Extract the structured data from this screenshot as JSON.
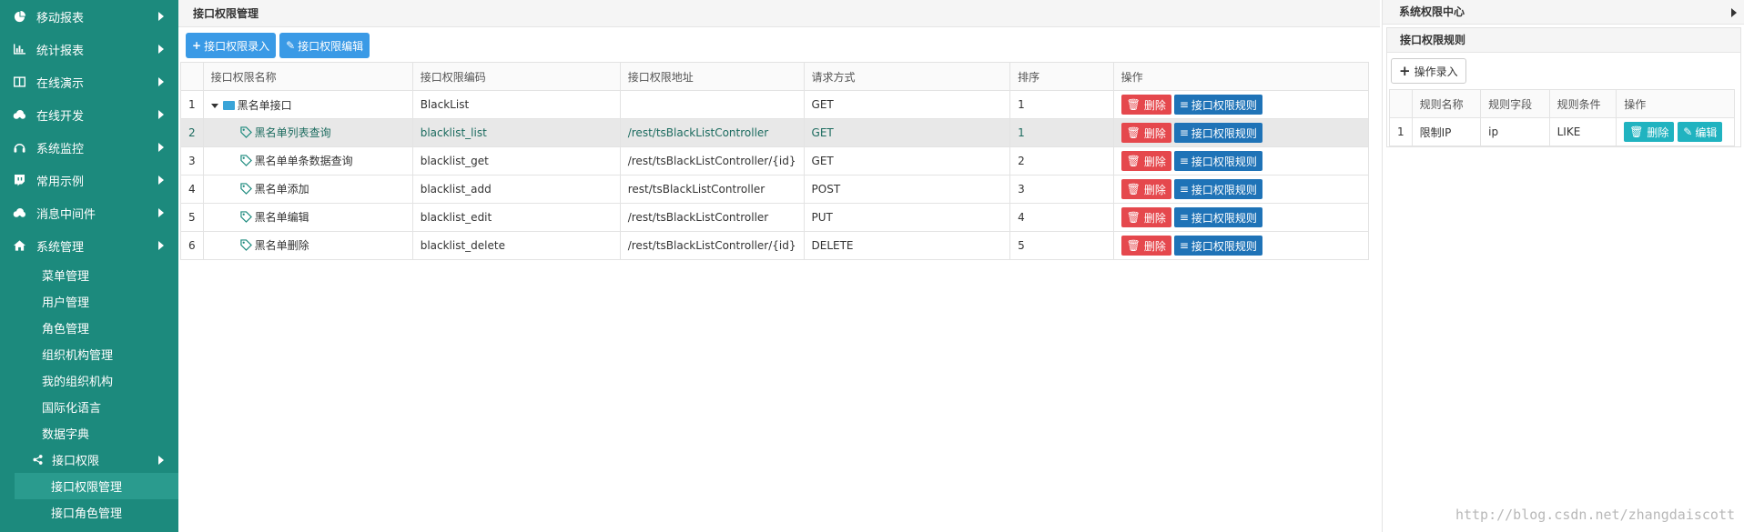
{
  "sidebar": {
    "menu": [
      {
        "label": "移动报表",
        "icon": "pie-chart-icon"
      },
      {
        "label": "统计报表",
        "icon": "bar-chart-icon"
      },
      {
        "label": "在线演示",
        "icon": "columns-icon"
      },
      {
        "label": "在线开发",
        "icon": "cloud-icon"
      },
      {
        "label": "系统监控",
        "icon": "headphones-icon"
      },
      {
        "label": "常用示例",
        "icon": "twitch-icon"
      },
      {
        "label": "消息中间件",
        "icon": "cloud-icon"
      },
      {
        "label": "系统管理",
        "icon": "home-icon"
      }
    ],
    "sub": [
      "菜单管理",
      "用户管理",
      "角色管理",
      "组织机构管理",
      "我的组织机构",
      "国际化语言",
      "数据字典"
    ],
    "sub_group": "接口权限",
    "sub_group_children": [
      "接口权限管理",
      "接口角色管理"
    ]
  },
  "main": {
    "title": "接口权限管理",
    "btn_add": "接口权限录入",
    "btn_edit": "接口权限编辑",
    "columns": [
      "接口权限名称",
      "接口权限编码",
      "接口权限地址",
      "请求方式",
      "排序",
      "操作"
    ],
    "rows": [
      {
        "idx": "1",
        "name": "黑名单接口",
        "code": "BlackList",
        "url": "",
        "method": "GET",
        "sort": "1"
      },
      {
        "idx": "2",
        "name": "黑名单列表查询",
        "code": "blacklist_list",
        "url": "/rest/tsBlackListController",
        "method": "GET",
        "sort": "1"
      },
      {
        "idx": "3",
        "name": "黑名单单条数据查询",
        "code": "blacklist_get",
        "url": "/rest/tsBlackListController/{id}",
        "method": "GET",
        "sort": "2"
      },
      {
        "idx": "4",
        "name": "黑名单添加",
        "code": "blacklist_add",
        "url": "rest/tsBlackListController",
        "method": "POST",
        "sort": "3"
      },
      {
        "idx": "5",
        "name": "黑名单编辑",
        "code": "blacklist_edit",
        "url": "/rest/tsBlackListController",
        "method": "PUT",
        "sort": "4"
      },
      {
        "idx": "6",
        "name": "黑名单删除",
        "code": "blacklist_delete",
        "url": "/rest/tsBlackListController/{id}",
        "method": "DELETE",
        "sort": "5"
      }
    ],
    "op_delete": "删除",
    "op_rule": "接口权限规则"
  },
  "right": {
    "title": "系统权限中心",
    "sub_title": "接口权限规则",
    "btn_add": "操作录入",
    "columns": [
      "规则名称",
      "规则字段",
      "规则条件",
      "操作"
    ],
    "rows": [
      {
        "idx": "1",
        "name": "限制IP",
        "field": "ip",
        "cond": "LIKE"
      }
    ],
    "op_delete": "删除",
    "op_edit": "编辑"
  },
  "watermark": "http://blog.csdn.net/zhangdaiscott",
  "colors": {
    "sidebar": "#1c8a7d",
    "primary": "#3a9ae6",
    "danger": "#e5484d",
    "rule": "#1f73b7",
    "teal": "#20b3c0"
  }
}
